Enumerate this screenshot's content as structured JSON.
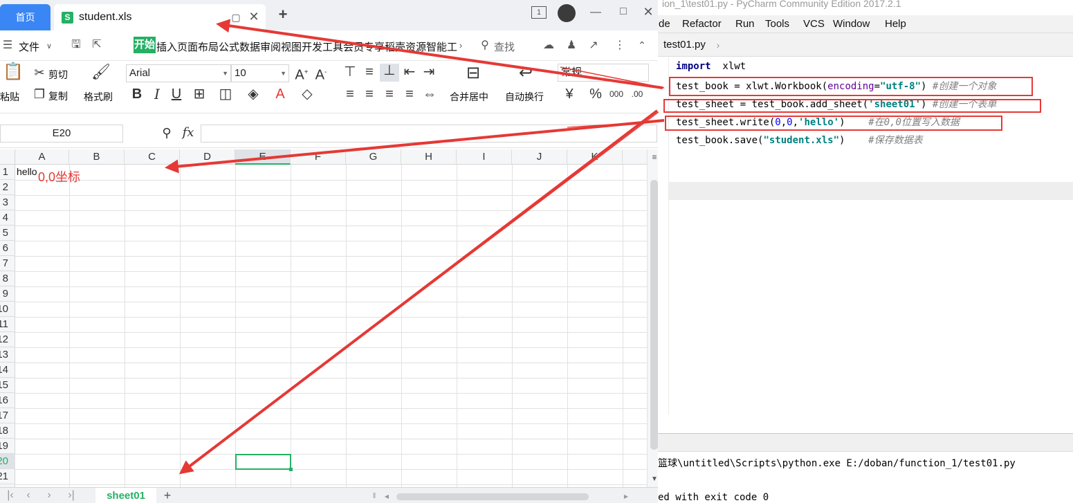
{
  "pycharm": {
    "title": "ion_1\\test01.py - PyCharm Community Edition 2017.2.1",
    "menu": [
      {
        "label": "de"
      },
      {
        "label": "Refactor"
      },
      {
        "label": "Run"
      },
      {
        "label": "Tools"
      },
      {
        "label": "VCS"
      },
      {
        "label": "Window"
      },
      {
        "label": "Help"
      }
    ],
    "tab": "test01.py",
    "code": {
      "l1_kw": "import",
      "l1_rest": "  xlwt",
      "l2_a": "test_book = xlwt.Workbook(",
      "l2_param": "encoding",
      "l2_eq": "=",
      "l2_str": "\"utf-8\"",
      "l2_close": ") ",
      "l2_cmt": "#创建一个对象",
      "l3_a": "test_sheet = test_book.add_sheet(",
      "l3_str": "'sheet01'",
      "l3_close": ") ",
      "l3_cmt": "#创建一个表单",
      "l4_a": "test_sheet.write(",
      "l4_n1": "0",
      "l4_c": ",",
      "l4_n2": "0",
      "l4_c2": ",",
      "l4_str": "'hello'",
      "l4_close": ")    ",
      "l4_cmt": "#在0,0位置写入数据",
      "l5_a": "test_book.save(",
      "l5_str": "\"student.xls\"",
      "l5_close": ")    ",
      "l5_cmt": "#保存数据表"
    },
    "run_output": {
      "line1": "篮球\\untitled\\Scripts\\python.exe E:/doban/function_1/test01.py",
      "line2": "ed with exit code 0"
    }
  },
  "wps": {
    "home_tab": "首页",
    "file_tab": "student.xls",
    "file_icon_letter": "S",
    "new_tab_symbol": "+",
    "badge": "1",
    "file_menu": "文件",
    "menu_tabs": [
      "开始",
      "插入",
      "页面布局",
      "公式",
      "数据",
      "审阅",
      "视图",
      "开发工具",
      "会员专享",
      "稻壳资源",
      "智能工"
    ],
    "search": "查找",
    "ribbon": {
      "paste": "粘贴",
      "cut": "剪切",
      "copy": "复制",
      "format_painter": "格式刷",
      "font_name": "Arial",
      "font_size": "10",
      "merge": "合并居中",
      "wrap": "自动换行",
      "number_format": "常规",
      "bold": "B",
      "italic": "I",
      "underline": "U"
    },
    "name_box": "E20",
    "fx": "fx",
    "columns": [
      "A",
      "B",
      "C",
      "D",
      "E",
      "F",
      "G",
      "H",
      "I",
      "J",
      "K"
    ],
    "selected_column": "E",
    "rows": [
      "1",
      "2",
      "3",
      "4",
      "5",
      "6",
      "7",
      "8",
      "9",
      "10",
      "11",
      "12",
      "13",
      "14",
      "15",
      "16",
      "17",
      "18",
      "19",
      "20",
      "21"
    ],
    "selected_row": "20",
    "cell_a1": "hello",
    "annotation": "0,0坐标",
    "sheet_tab": "sheet01"
  },
  "colors": {
    "accent_green": "#25b065",
    "home_blue": "#3a86f5",
    "annotation_red": "#e53935"
  }
}
